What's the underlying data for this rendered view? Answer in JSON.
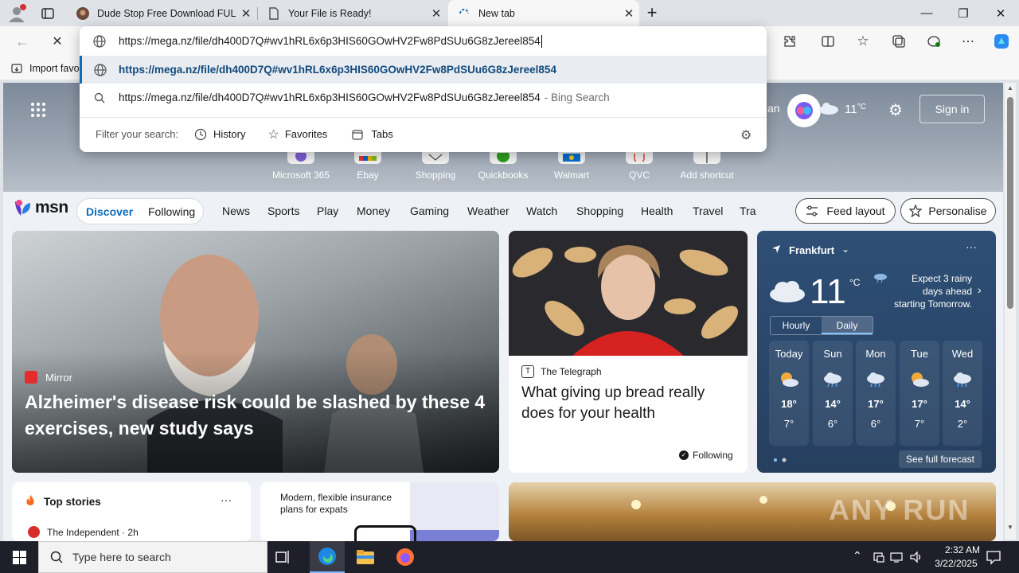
{
  "tabs": [
    {
      "title": "Dude Stop Free Download FULL V",
      "favicon": "avatar-favicon"
    },
    {
      "title": "Your File is Ready!",
      "favicon": "document-favicon"
    },
    {
      "title": "New tab",
      "favicon": "loading-favicon"
    }
  ],
  "address_bar": {
    "value": "https://mega.nz/file/dh400D7Q#wv1hRL6x6p3HIS60GOwHV2Fw8PdSUu6G8zJereel854"
  },
  "omnibox": {
    "suggestion_url": "https://mega.nz/file/dh400D7Q#wv1hRL6x6p3HIS60GOwHV2Fw8PdSUu6G8zJereel854",
    "search_text": "https://mega.nz/file/dh400D7Q#wv1hRL6x6p3HIS60GOwHV2Fw8PdSUu6G8zJereel854",
    "search_suffix": "- Bing Search",
    "filter_label": "Filter your search:",
    "filters": [
      "History",
      "Favorites",
      "Tabs"
    ]
  },
  "favorites_bar": {
    "import_label": "Import favo"
  },
  "hero": {
    "weather_temp": "11",
    "weather_unit": "°C",
    "partial_text": "an",
    "sign_in": "Sign in"
  },
  "shortcuts": [
    "Microsoft 365",
    "Ebay",
    "Shopping",
    "Quickbooks",
    "Walmart",
    "QVC",
    "Add shortcut"
  ],
  "msn": {
    "logo": "msn",
    "tabs": [
      "Discover",
      "Following"
    ],
    "nav": [
      "News",
      "Sports",
      "Play",
      "Money",
      "Gaming",
      "Weather",
      "Watch",
      "Shopping",
      "Health",
      "Travel",
      "Tra"
    ],
    "feed_layout": "Feed layout",
    "personalise": "Personalise"
  },
  "main_story": {
    "source": "Mirror",
    "headline": "Alzheimer's disease risk could be slashed by these 4 exercises, new study says"
  },
  "second_story": {
    "source": "The Telegraph",
    "headline": "What giving up bread really does for your health",
    "following": "Following"
  },
  "weather": {
    "location": "Frankfurt",
    "temp": "11",
    "unit": "°C",
    "alert": "Expect 3 rainy days ahead starting Tomorrow.",
    "tabs": [
      "Hourly",
      "Daily"
    ],
    "days": [
      {
        "day": "Today",
        "high": "18°",
        "low": "7°",
        "icon": "sun-cloud-icon"
      },
      {
        "day": "Sun",
        "high": "14°",
        "low": "6°",
        "icon": "rain-cloud-icon"
      },
      {
        "day": "Mon",
        "high": "17°",
        "low": "6°",
        "icon": "rain-cloud-icon"
      },
      {
        "day": "Tue",
        "high": "17°",
        "low": "7°",
        "icon": "sun-cloud-icon"
      },
      {
        "day": "Wed",
        "high": "14°",
        "low": "2°",
        "icon": "rain-cloud-icon"
      }
    ],
    "see_full": "See full forecast"
  },
  "top_stories": {
    "title": "Top stories",
    "first_source": "The Independent · 2h"
  },
  "ad": {
    "text": "Modern, flexible insurance plans for expats"
  },
  "watermark": "ANY RUN",
  "taskbar": {
    "search_placeholder": "Type here to search",
    "time": "2:32 AM",
    "date": "3/22/2025"
  },
  "colors": {
    "accent": "#0f6cbd",
    "chrome_bg": "#dfe3e8",
    "toolbar_bg": "#f7f7f7",
    "weather_bg": "#2e4f76",
    "taskbar_bg": "#1f1f2a"
  }
}
